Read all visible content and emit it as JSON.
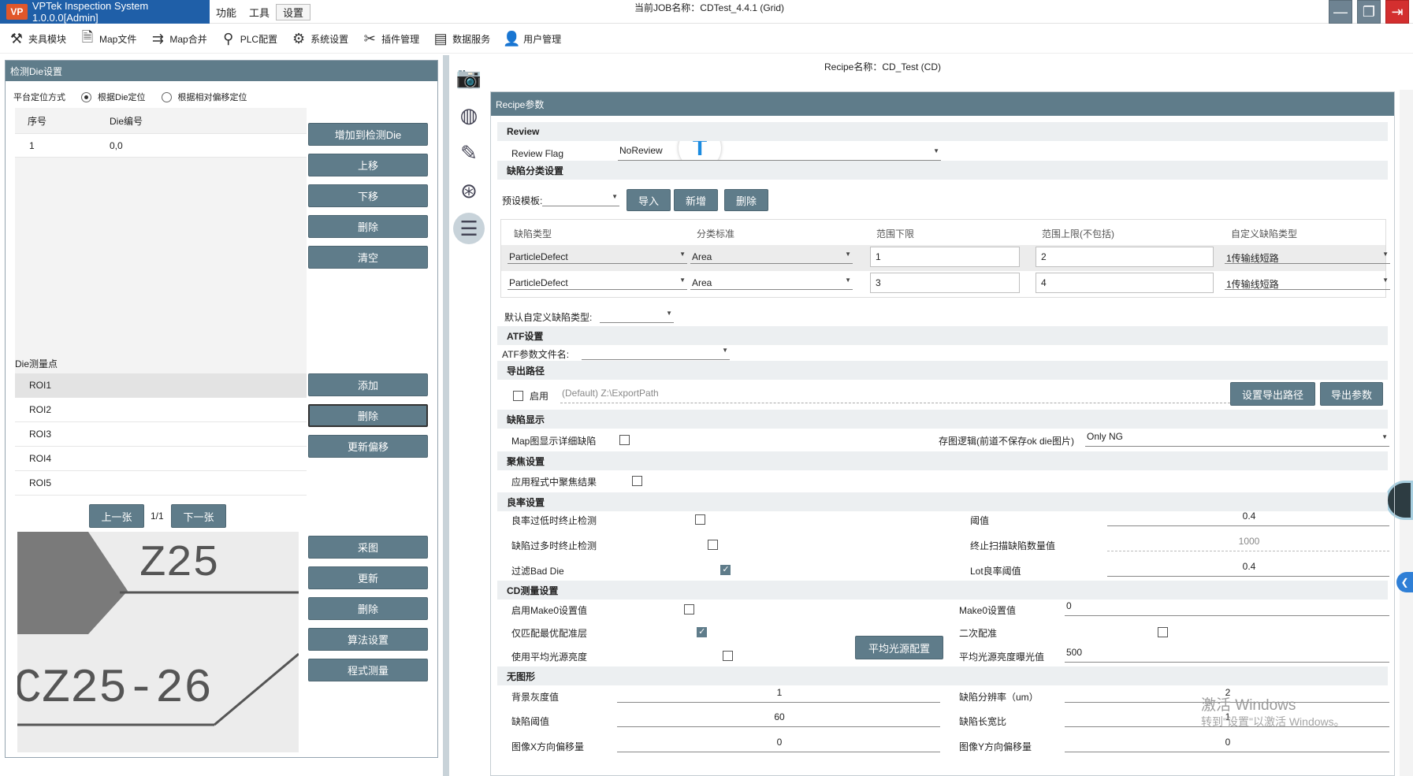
{
  "app": {
    "title": "VPTek Inspection System 1.0.0.0[Admin]",
    "logo": "VP",
    "menu": [
      "功能",
      "工具",
      "设置"
    ],
    "job": "当前JOB名称：CDTest_4.4.1 (Grid)"
  },
  "window": {
    "min": "—",
    "max": "❐",
    "close": "⇥"
  },
  "toolbar": [
    {
      "label": "夹具模块",
      "icon": "fixture-icon",
      "glyph": "⚒"
    },
    {
      "label": "Map文件",
      "icon": "map-file-icon",
      "glyph": "🗎"
    },
    {
      "label": "Map合并",
      "icon": "map-merge-icon",
      "glyph": "⇉"
    },
    {
      "label": "PLC配置",
      "icon": "plc-icon",
      "glyph": "⚲"
    },
    {
      "label": "系统设置",
      "icon": "gear-icon",
      "glyph": "⚙"
    },
    {
      "label": "插件管理",
      "icon": "plugin-icon",
      "glyph": "✂"
    },
    {
      "label": "数据服务",
      "icon": "data-service-icon",
      "glyph": "▤"
    },
    {
      "label": "用户管理",
      "icon": "user-icon",
      "glyph": "👤"
    }
  ],
  "left": {
    "title": "检测Die设置",
    "platform_label": "平台定位方式",
    "radio1": "根据Die定位",
    "radio2": "根据相对偏移定位",
    "table_headers": [
      "序号",
      "Die编号"
    ],
    "die_rows": [
      {
        "idx": "1",
        "no": "0,0"
      }
    ],
    "die_buttons": [
      "增加到检测Die",
      "上移",
      "下移",
      "删除",
      "清空"
    ],
    "measure_label": "Die测量点",
    "roi": [
      "ROI1",
      "ROI2",
      "ROI3",
      "ROI4",
      "ROI5"
    ],
    "roi_buttons": [
      "添加",
      "删除",
      "更新偏移"
    ],
    "prev": "上一张",
    "page": "1/1",
    "next": "下一张",
    "img_buttons": [
      "采图",
      "更新",
      "删除",
      "算法设置",
      "程式测量"
    ],
    "img_text1": "Z25",
    "img_text2": "CZ25-26"
  },
  "side_icons": [
    "camera-icon",
    "wafer-map-icon",
    "ruler-icon",
    "settings-chip-icon",
    "checklist-icon"
  ],
  "side_glyphs": [
    "📷",
    "◍",
    "✎",
    "⊛",
    "☰"
  ],
  "recipe": {
    "name_label": "Recipe名称：CD_Test (CD)",
    "header": "Recipe参数",
    "review": {
      "title": "Review",
      "flag_label": "Review Flag",
      "flag_value": "NoReview"
    },
    "defect_cls": {
      "title": "缺陷分类设置",
      "preset_label": "预设模板:",
      "btns": [
        "导入",
        "新增",
        "删除"
      ],
      "headers": [
        "缺陷类型",
        "分类标准",
        "范围下限",
        "范围上限(不包括)",
        "自定义缺陷类型"
      ],
      "rows": [
        [
          "ParticleDefect",
          "Area",
          "1",
          "2",
          "1传输线短路"
        ],
        [
          "ParticleDefect",
          "Area",
          "3",
          "4",
          "1传输线短路"
        ]
      ],
      "default_label": "默认自定义缺陷类型:"
    },
    "atf": {
      "title": "ATF设置",
      "label": "ATF参数文件名:"
    },
    "export": {
      "title": "导出路径",
      "enable": "启用",
      "path": "(Default) Z:\\ExportPath",
      "btn1": "设置导出路径",
      "btn2": "导出参数"
    },
    "defect_show": {
      "title": "缺陷显示",
      "map_detail": "Map图显示详细缺陷",
      "save_logic": "存图逻辑(前道不保存ok die图片)",
      "save_value": "Only NG"
    },
    "focus": {
      "title": "聚焦设置",
      "apply": "应用程式中聚焦结果"
    },
    "yield": {
      "title": "良率设置",
      "low_stop": "良率过低时终止检测",
      "many_stop": "缺陷过多时终止检测",
      "filter": "过滤Bad Die",
      "thresh": "阈值",
      "thresh_v": "0.4",
      "stop_count": "终止扫描缺陷数量值",
      "stop_count_v": "1000",
      "lot": "Lot良率阈值",
      "lot_v": "0.4"
    },
    "cd": {
      "title": "CD测量设置",
      "make0": "启用Make0设置值",
      "make0_val": "Make0设置值",
      "make0_v": "0",
      "best": "仅匹配最优配准层",
      "second": "二次配准",
      "avg": "使用平均光源亮度",
      "avg_btn": "平均光源配置",
      "avg_exp": "平均光源亮度曝光值",
      "avg_exp_v": "500"
    },
    "nopattern": {
      "title": "无图形",
      "bg": "背景灰度值",
      "bg_v": "1",
      "res": "缺陷分辨率（um）",
      "res_v": "2",
      "th": "缺陷阈值",
      "th_v": "60",
      "ratio": "缺陷长宽比",
      "ratio_v": "1",
      "xoff": "图像X方向偏移量",
      "xoff_v": "0",
      "yoff": "图像Y方向偏移量",
      "yoff_v": "0"
    }
  },
  "watermark": {
    "line1": "激活 Windows",
    "line2": "转到\"设置\"以激活 Windows。"
  },
  "colors": {
    "accent": "#5f7c8a",
    "title_blue": "#1f5fa8"
  }
}
